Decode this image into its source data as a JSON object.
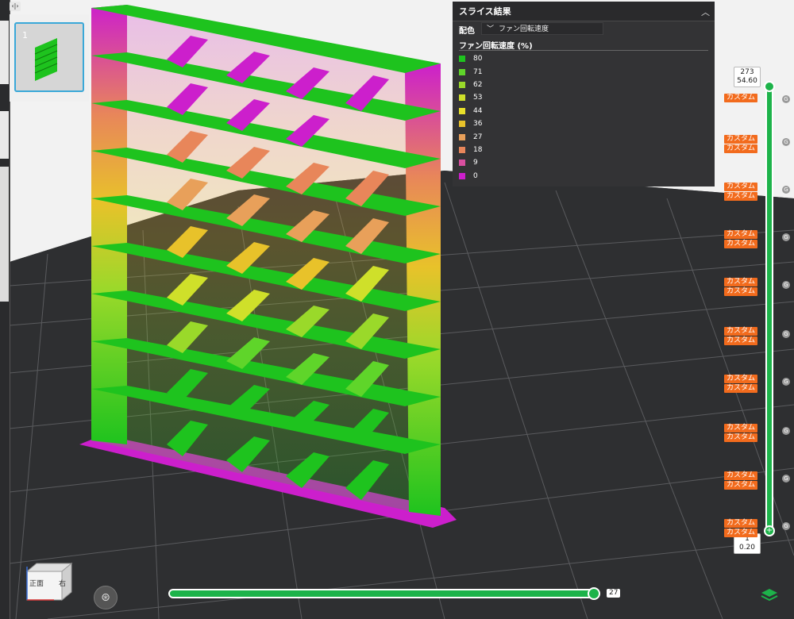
{
  "toolbar": {
    "toggle_label": "‹|›"
  },
  "plate": {
    "thumbnail_number": "1"
  },
  "slice_panel": {
    "title": "スライス結果",
    "scheme_label": "配色",
    "scheme_value": "ファン回転速度",
    "legend_title": "ファン回転速度 (%)",
    "legend": [
      {
        "value": "80",
        "color": "#1ec31e"
      },
      {
        "value": "71",
        "color": "#5fd52a"
      },
      {
        "value": "62",
        "color": "#9ad92a"
      },
      {
        "value": "53",
        "color": "#cfe02a"
      },
      {
        "value": "44",
        "color": "#e8e02a"
      },
      {
        "value": "36",
        "color": "#e8c22a"
      },
      {
        "value": "27",
        "color": "#e8a05a"
      },
      {
        "value": "18",
        "color": "#e8865a"
      },
      {
        "value": "9",
        "color": "#d94fa0"
      },
      {
        "value": "0",
        "color": "#cc1fcc"
      }
    ]
  },
  "layer_slider": {
    "top_layer": "273",
    "top_height": "54.60",
    "bottom_layer": "1",
    "bottom_height": "0.20",
    "tag_text": "カスタム",
    "badge_text": "G"
  },
  "move_slider": {
    "value": "27"
  },
  "viewcube": {
    "front": "正面",
    "right": "右"
  },
  "colors": {
    "accent": "#1db34a",
    "tag": "#f26b1d"
  }
}
